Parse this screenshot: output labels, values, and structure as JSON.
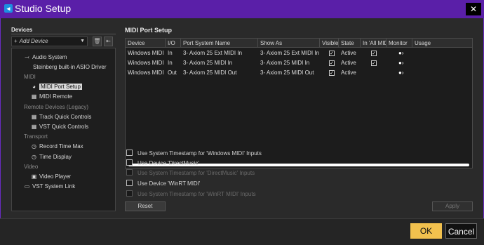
{
  "window": {
    "title": "Studio Setup",
    "close": "✕",
    "app_icon": "cubase-icon"
  },
  "left": {
    "header": "Devices",
    "add_device": "Add Device",
    "tree": {
      "audio_system": "Audio System",
      "asio_driver": "Steinberg built-in ASIO Driver",
      "midi_cat": "MIDI",
      "midi_port_setup": "MIDI Port Setup",
      "midi_remote": "MIDI Remote",
      "remote_cat": "Remote Devices (Legacy)",
      "track_quick": "Track Quick Controls",
      "vst_quick": "VST Quick Controls",
      "transport_cat": "Transport",
      "record_time_max": "Record Time Max",
      "time_display": "Time Display",
      "video_cat": "Video",
      "video_player": "Video Player",
      "vst_system_link": "VST System Link"
    }
  },
  "right": {
    "header": "MIDI Port Setup",
    "columns": [
      "Device",
      "I/O",
      "Port System Name",
      "Show As",
      "Visible",
      "State",
      "In 'All MIDI",
      "Monitor",
      "Usage"
    ],
    "rows": [
      {
        "device": "Windows MIDI",
        "io": "In",
        "port": "3- Axiom 25 Ext MIDI In",
        "show_as": "3- Axiom 25 Ext MIDI In",
        "visible": true,
        "state": "Active",
        "in_all": true,
        "monitor": true,
        "usage": ""
      },
      {
        "device": "Windows MIDI",
        "io": "In",
        "port": "3- Axiom 25 MIDI In",
        "show_as": "3- Axiom 25 MIDI In",
        "visible": true,
        "state": "Active",
        "in_all": true,
        "monitor": true,
        "usage": ""
      },
      {
        "device": "Windows MIDI",
        "io": "Out",
        "port": "3- Axiom 25 MIDI Out",
        "show_as": "3- Axiom 25 MIDI Out",
        "visible": true,
        "state": "Active",
        "in_all": false,
        "monitor": true,
        "usage": ""
      }
    ],
    "options": [
      {
        "label": "Use System Timestamp for 'Windows MIDI' Inputs",
        "enabled": true
      },
      {
        "label": "Use Device 'DirectMusic'",
        "enabled": true
      },
      {
        "label": "Use System Timestamp for 'DirectMusic' Inputs",
        "enabled": false
      },
      {
        "label": "Use Device 'WinRT MIDI'",
        "enabled": true
      },
      {
        "label": "Use System Timestamp for 'WinRT MIDI' Inputs",
        "enabled": false
      }
    ],
    "reset": "Reset",
    "apply": "Apply"
  },
  "footer": {
    "ok": "OK",
    "cancel": "Cancel"
  },
  "colors": {
    "title_bar": "#5a1fa8",
    "ok_button": "#f2c14e",
    "selection": "#d9d9d9"
  }
}
